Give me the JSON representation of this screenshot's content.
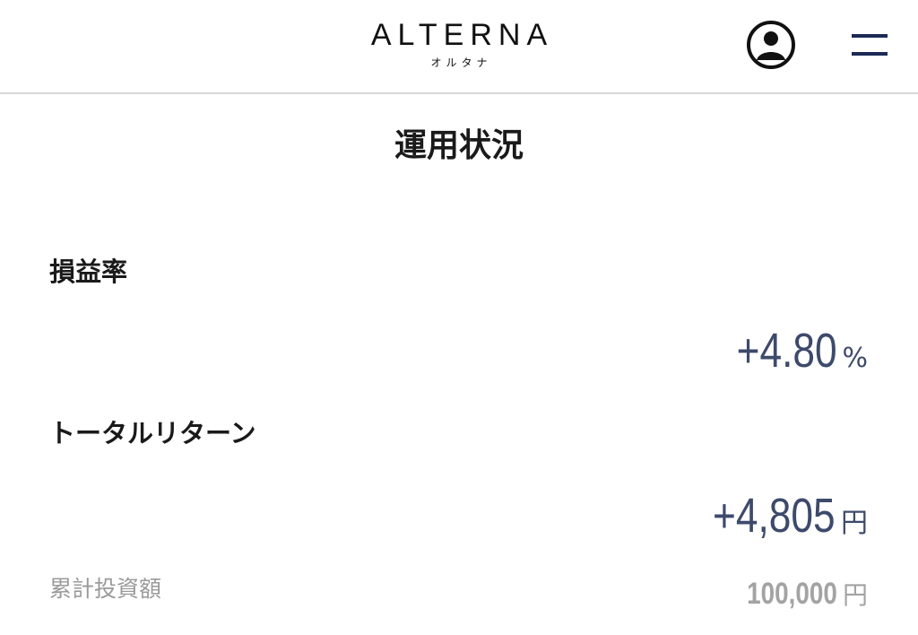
{
  "header": {
    "logo_text": "ALTERNA",
    "logo_subtext": "オルタナ",
    "user_icon": "user-circle-icon",
    "menu_icon": "hamburger-menu-icon"
  },
  "page": {
    "title": "運用状況"
  },
  "metrics": {
    "profit_rate": {
      "label": "損益率",
      "value": "+4.80",
      "unit": "%"
    },
    "total_return": {
      "label": "トータルリターン",
      "value": "+4,805",
      "unit": "円"
    },
    "cumulative_investment": {
      "label": "累計投資額",
      "value": "100,000",
      "unit": "円"
    }
  },
  "colors": {
    "accent": "#3d4a6b",
    "muted": "#9a9a9a",
    "text": "#1a1a1a",
    "divider": "#d6d6d6",
    "menu_icon": "#1c2a55"
  }
}
